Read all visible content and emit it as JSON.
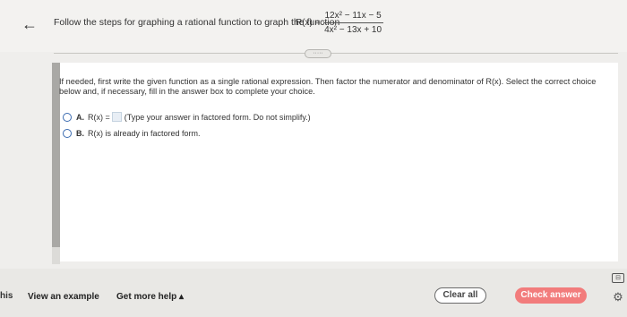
{
  "header": {
    "back_icon": "←",
    "question_text": "Follow the steps for graphing a rational function to graph the function",
    "func_label": "R(x) =",
    "numerator": "12x² − 11x − 5",
    "denominator": "4x² − 13x + 10",
    "more_pill": "·····"
  },
  "panel": {
    "instructions": "If needed, first write the given function as a single rational expression. Then factor the numerator and denominator of R(x). Select the correct choice below and, if necessary, fill in the answer box to complete your choice.",
    "choice_a_letter": "A.",
    "choice_a_prefix": "R(x) =",
    "choice_a_suffix": "(Type your answer in factored form. Do not simplify.)",
    "choice_b_letter": "B.",
    "choice_b_text": "R(x) is already in factored form."
  },
  "footer": {
    "edge_text": "his",
    "view_example": "View an example",
    "get_help": "Get more help ▴",
    "clear_all": "Clear all",
    "check_answer": "Check answer",
    "side_icon_1": "⊟",
    "side_icon_2": "⚙"
  },
  "colors": {
    "check_answer_bg": "#f27c7c",
    "radio_border": "#3b6bb0"
  }
}
